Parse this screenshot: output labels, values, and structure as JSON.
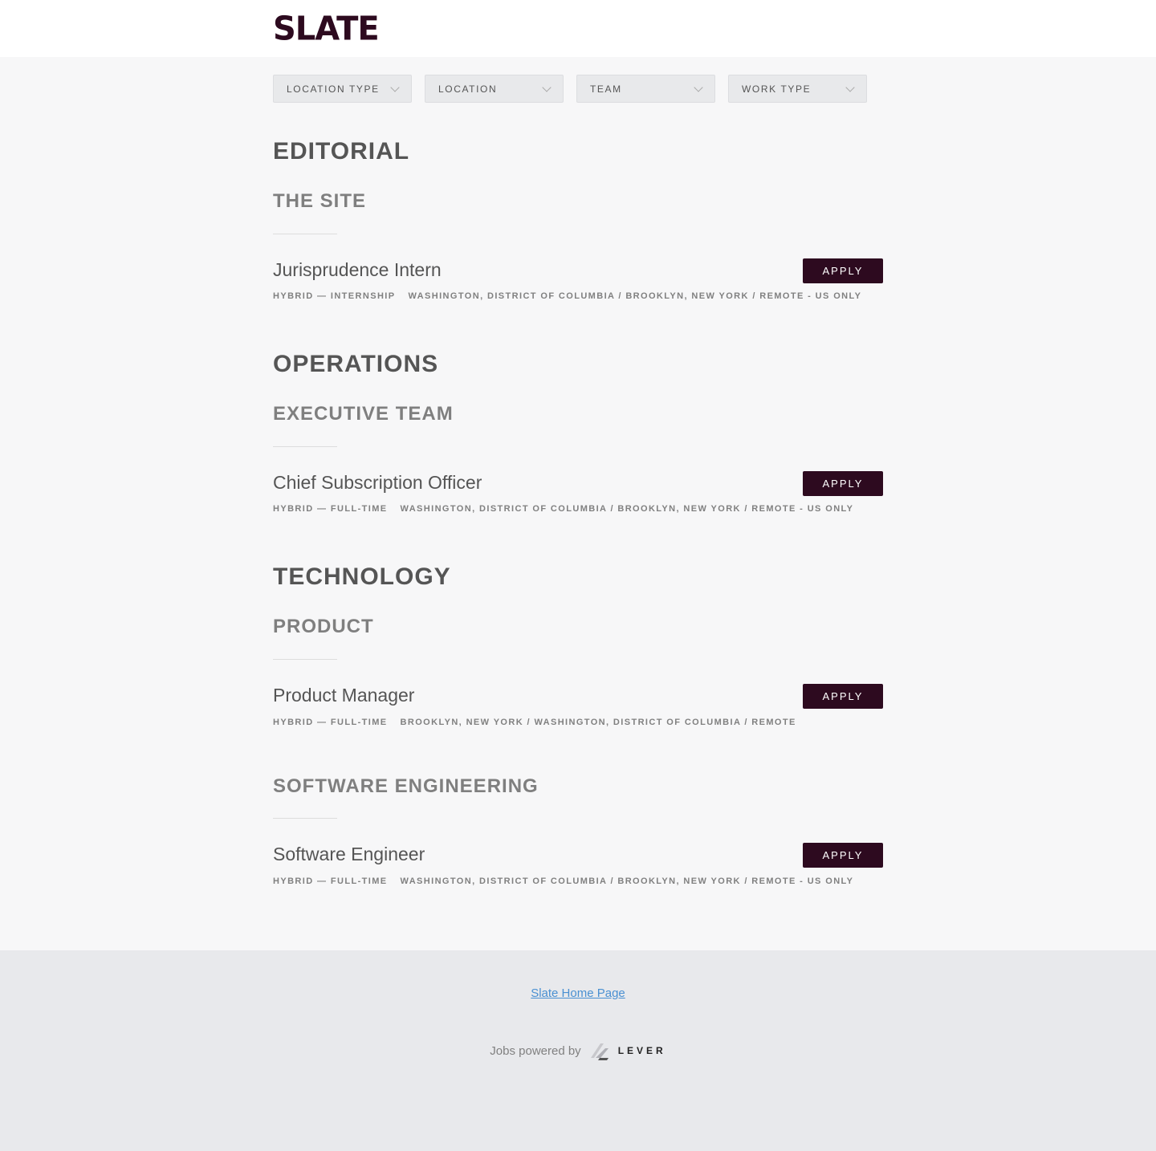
{
  "header": {
    "logo_text": "SLATE"
  },
  "filters": [
    {
      "label": "LOCATION TYPE"
    },
    {
      "label": "LOCATION"
    },
    {
      "label": "TEAM"
    },
    {
      "label": "WORK TYPE"
    }
  ],
  "departments": [
    {
      "name": "EDITORIAL",
      "teams": [
        {
          "name": "THE SITE",
          "jobs": [
            {
              "title": "Jurisprudence Intern",
              "type": "HYBRID — INTERNSHIP",
              "locations": "WASHINGTON, DISTRICT OF COLUMBIA / BROOKLYN, NEW YORK / REMOTE - US ONLY",
              "apply_label": "APPLY"
            }
          ]
        }
      ]
    },
    {
      "name": "OPERATIONS",
      "teams": [
        {
          "name": "EXECUTIVE TEAM",
          "jobs": [
            {
              "title": "Chief Subscription Officer",
              "type": "HYBRID — FULL-TIME",
              "locations": "WASHINGTON, DISTRICT OF COLUMBIA / BROOKLYN, NEW YORK / REMOTE - US ONLY",
              "apply_label": "APPLY"
            }
          ]
        }
      ]
    },
    {
      "name": "TECHNOLOGY",
      "teams": [
        {
          "name": "PRODUCT",
          "jobs": [
            {
              "title": "Product Manager",
              "type": "HYBRID — FULL-TIME",
              "locations": "BROOKLYN, NEW YORK / WASHINGTON, DISTRICT OF COLUMBIA / REMOTE",
              "apply_label": "APPLY"
            }
          ]
        },
        {
          "name": "SOFTWARE ENGINEERING",
          "jobs": [
            {
              "title": "Software Engineer",
              "type": "HYBRID — FULL-TIME",
              "locations": "WASHINGTON, DISTRICT OF COLUMBIA / BROOKLYN, NEW YORK / REMOTE - US ONLY",
              "apply_label": "APPLY"
            }
          ]
        }
      ]
    }
  ],
  "footer": {
    "home_link": "Slate Home Page",
    "powered_by": "Jobs powered by",
    "lever_word": "LEVER"
  },
  "colors": {
    "brand": "#2d0a1f",
    "link": "#4a90d2"
  },
  "icons": {
    "filter_chevron": "chevron-down-icon",
    "lever_logo": "lever-logo-icon"
  }
}
